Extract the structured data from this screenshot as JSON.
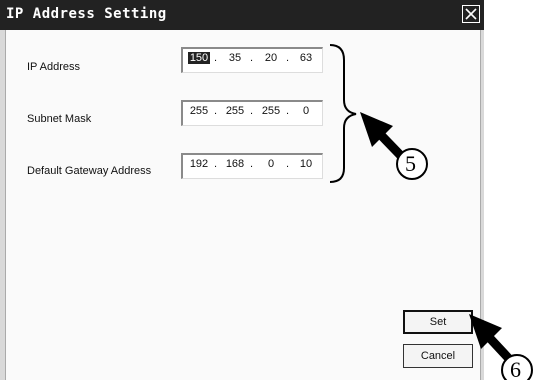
{
  "window": {
    "title": "IP Address Setting"
  },
  "fields": [
    {
      "label": "IP Address",
      "octets": [
        "150",
        "35",
        "20",
        "63"
      ]
    },
    {
      "label": "Subnet Mask",
      "octets": [
        "255",
        "255",
        "255",
        "0"
      ]
    },
    {
      "label": "Default Gateway Address",
      "octets": [
        "192",
        "168",
        "0",
        "10"
      ]
    }
  ],
  "buttons": {
    "set": "Set",
    "cancel": "Cancel"
  },
  "callouts": {
    "a": "5",
    "b": "6"
  }
}
